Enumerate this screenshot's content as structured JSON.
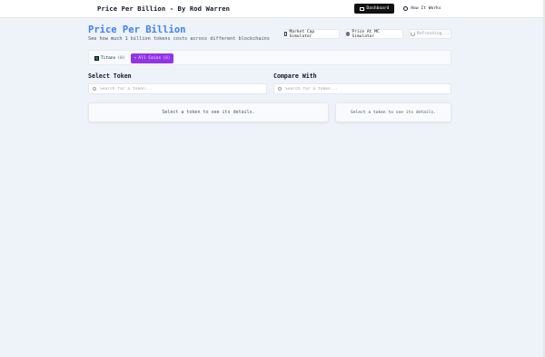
{
  "header": {
    "brand": "Price Per Billion - By Rod Warren",
    "nav": {
      "dashboard": "Dashboard",
      "how_it_works": "How It Works"
    }
  },
  "main": {
    "title": "Price Per Billion",
    "subtitle": "See how much 1 billion tokens costs across different blockchains",
    "tools": {
      "market_cap_simulator": "Market Cap Simulator",
      "price_at_mc_simulator": "Price At MC Simulator",
      "refreshing": "Refreshing..."
    },
    "filters": {
      "titans_label": "Titans",
      "titans_count": "(0)",
      "all_coins_label": "All Coins",
      "all_coins_count": "(0)"
    },
    "select_token": {
      "heading": "Select Token",
      "placeholder": "Search for a token...",
      "empty_message": "Select a token to see its details."
    },
    "compare_with": {
      "heading": "Compare With",
      "placeholder": "Search for a token...",
      "empty_message": "Select a token to see its details."
    }
  },
  "colors": {
    "accent_title": "#3b82f6",
    "all_coins_chip": "#9333ea",
    "dashboard_button": "#111111",
    "background": "#eef2f9"
  },
  "icons": {
    "dashboard": "layout-icon",
    "how_it_works": "help-circle-icon",
    "market_cap": "calculator-icon",
    "price_at_mc": "dollar-circle-icon",
    "refresh": "refresh-icon",
    "titans": "flag-icon",
    "all_coins": "sparkle-icon",
    "search": "search-icon"
  }
}
